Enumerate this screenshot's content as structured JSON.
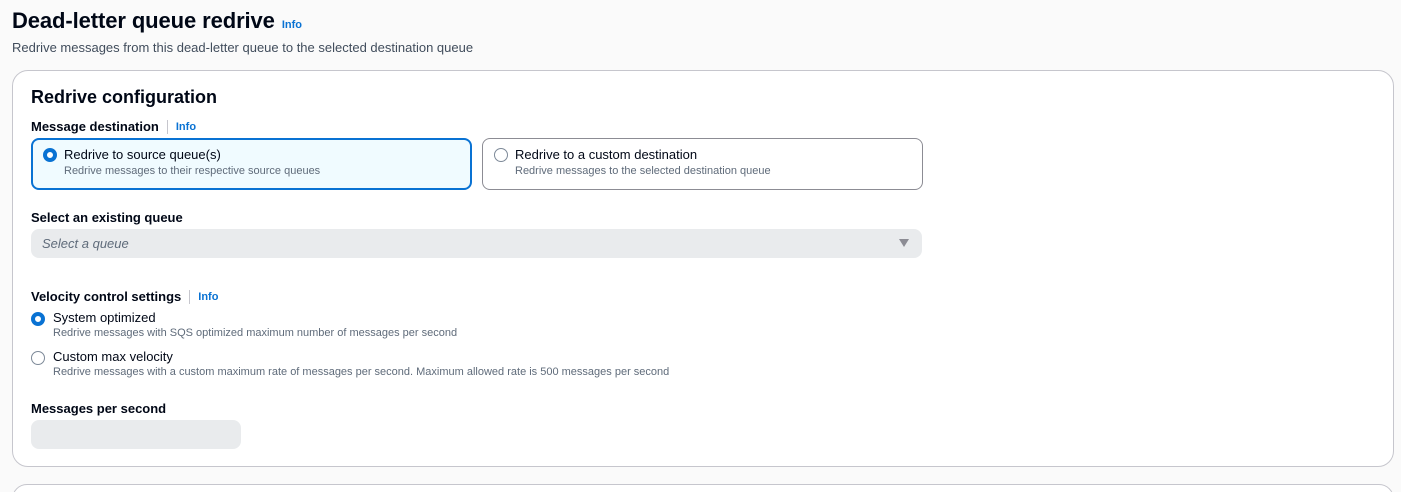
{
  "header": {
    "title": "Dead-letter queue redrive",
    "info": "Info",
    "description": "Redrive messages from this dead-letter queue to the selected destination queue"
  },
  "config": {
    "title": "Redrive configuration",
    "destination": {
      "label": "Message destination",
      "info": "Info",
      "options": [
        {
          "title": "Redrive to source queue(s)",
          "description": "Redrive messages to their respective source queues",
          "selected": true
        },
        {
          "title": "Redrive to a custom destination",
          "description": "Redrive messages to the selected destination queue",
          "selected": false
        }
      ]
    },
    "queue_select": {
      "label": "Select an existing queue",
      "placeholder": "Select a queue"
    },
    "velocity": {
      "label": "Velocity control settings",
      "info": "Info",
      "options": [
        {
          "title": "System optimized",
          "description": "Redrive messages with SQS optimized maximum number of messages per second",
          "selected": true
        },
        {
          "title": "Custom max velocity",
          "description": "Redrive messages with a custom maximum rate of messages per second. Maximum allowed rate is 500 messages per second",
          "selected": false
        }
      ]
    },
    "messages_per_second": {
      "label": "Messages per second",
      "value": ""
    }
  },
  "colors": {
    "accent": "#0972d3",
    "selected_tile_bg": "#f0fbff",
    "disabled_field_bg": "#e9ebed"
  },
  "icons": {
    "select_caret": "caret-down-icon"
  }
}
